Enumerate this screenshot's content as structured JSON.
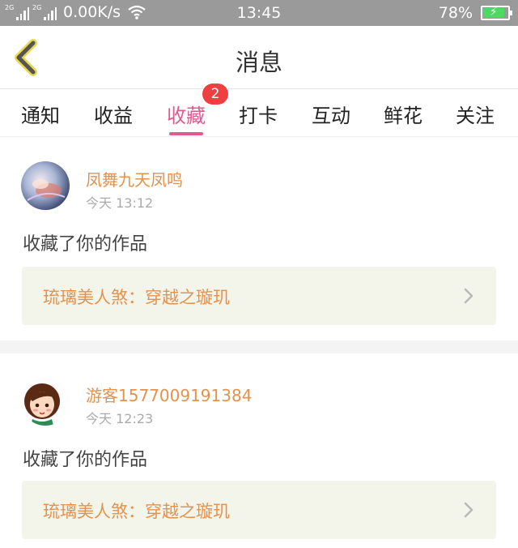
{
  "status_bar": {
    "net1": "2G",
    "net2": "2G",
    "speed": "0.00K/s",
    "time": "13:45",
    "battery": "78%"
  },
  "header": {
    "title": "消息"
  },
  "tabs": [
    {
      "label": "通知"
    },
    {
      "label": "收益"
    },
    {
      "label": "收藏",
      "active": true
    },
    {
      "label": "打卡"
    },
    {
      "label": "互动"
    },
    {
      "label": "鲜花"
    },
    {
      "label": "关注"
    }
  ],
  "badge": "2",
  "messages": [
    {
      "username": "凤舞九天凤鸣",
      "time": "今天 13:12",
      "action": "收藏了你的作品",
      "work_title": "琉璃美人煞：穿越之璇玑"
    },
    {
      "username": "游客1577009191384",
      "time": "今天 12:23",
      "action": "收藏了你的作品",
      "work_title": "琉璃美人煞：穿越之璇玑"
    }
  ],
  "colors": {
    "accent": "#e0598f",
    "username": "#e3924e",
    "badge": "#ef3f3f"
  }
}
